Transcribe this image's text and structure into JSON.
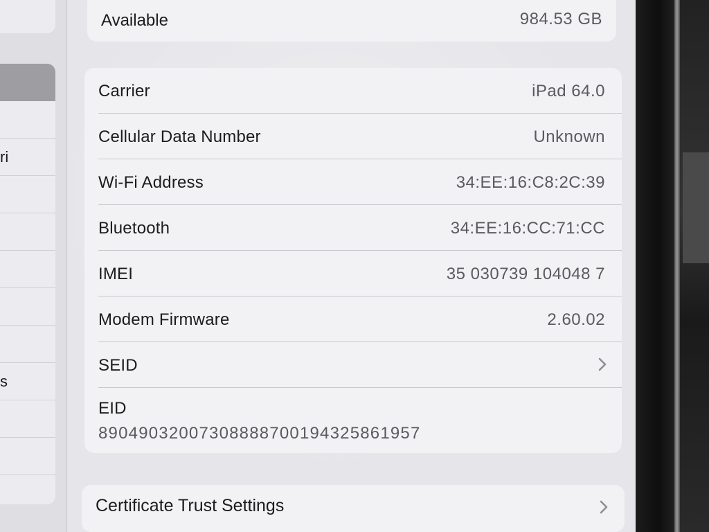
{
  "storage": {
    "available_label": "Available",
    "available_value": "984.53 GB"
  },
  "info_rows": [
    {
      "label": "Carrier",
      "value": "iPad 64.0"
    },
    {
      "label": "Cellular Data Number",
      "value": "Unknown"
    },
    {
      "label": "Wi-Fi Address",
      "value": "34:EE:16:C8:2C:39"
    },
    {
      "label": "Bluetooth",
      "value": "34:EE:16:CC:71:CC"
    },
    {
      "label": "IMEI",
      "value": "35 030739 104048 7"
    },
    {
      "label": "Modem Firmware",
      "value": "2.60.02"
    }
  ],
  "seid": {
    "label": "SEID",
    "icon": "chevron-right-icon"
  },
  "eid": {
    "label": "EID",
    "value": "89049032007308888700194325861957"
  },
  "certificate": {
    "label": "Certificate Trust Settings",
    "icon": "chevron-right-icon"
  },
  "sidebar": {
    "partial_labels": [
      "ri",
      "s"
    ]
  },
  "colors": {
    "screen_bg": "#e6e6ea",
    "card_bg": "#f2f2f5",
    "label_text": "#1c1c1e",
    "value_text": "#5a5a5f",
    "sidebar_selected": "#9d9da2"
  }
}
